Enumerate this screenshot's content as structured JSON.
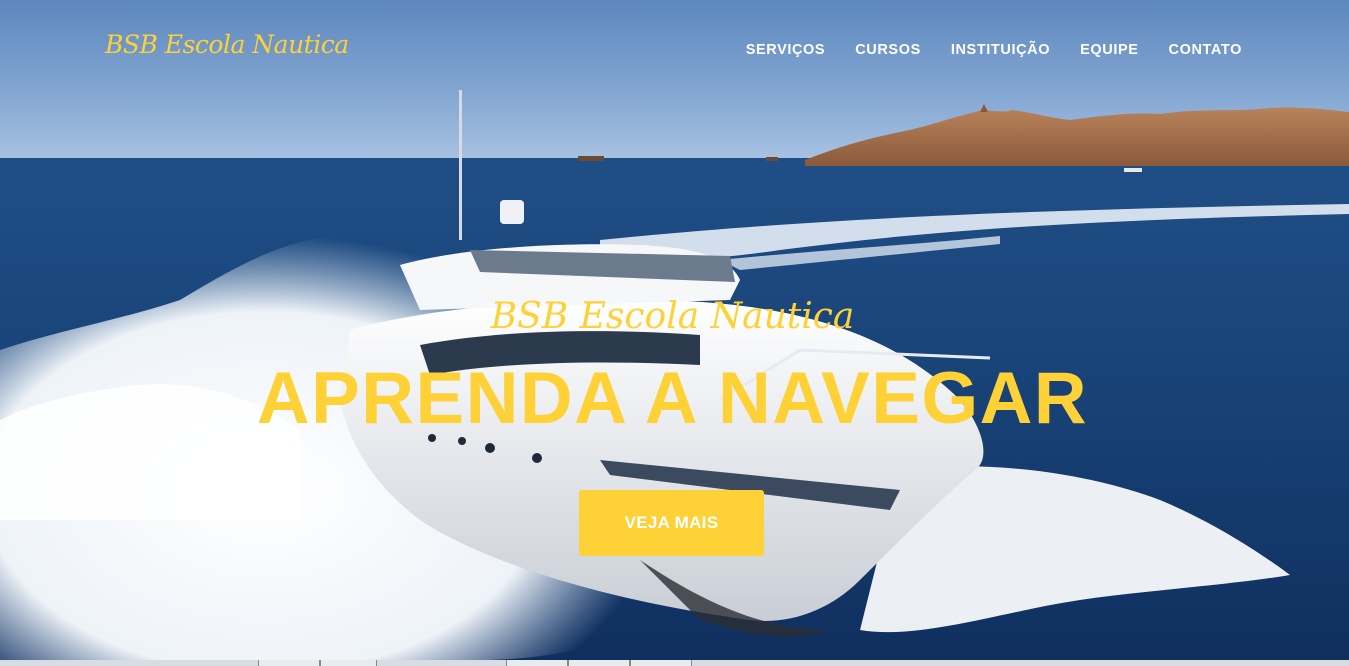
{
  "navbar": {
    "brand": "BSB Escola Nautica",
    "items": [
      {
        "label": "SERVIÇOS"
      },
      {
        "label": "CURSOS"
      },
      {
        "label": "INSTITUIÇÃO"
      },
      {
        "label": "EQUIPE"
      },
      {
        "label": "CONTATO"
      }
    ]
  },
  "hero": {
    "lead_in": "BSB Escola Nautica",
    "heading": "APRENDA A NAVEGAR",
    "button_label": "VEJA MAIS",
    "image": "yacht-on-sea-photo"
  },
  "colors": {
    "accent": "#fed136",
    "nav_text": "#ffffff",
    "button_text": "#ffffff"
  }
}
